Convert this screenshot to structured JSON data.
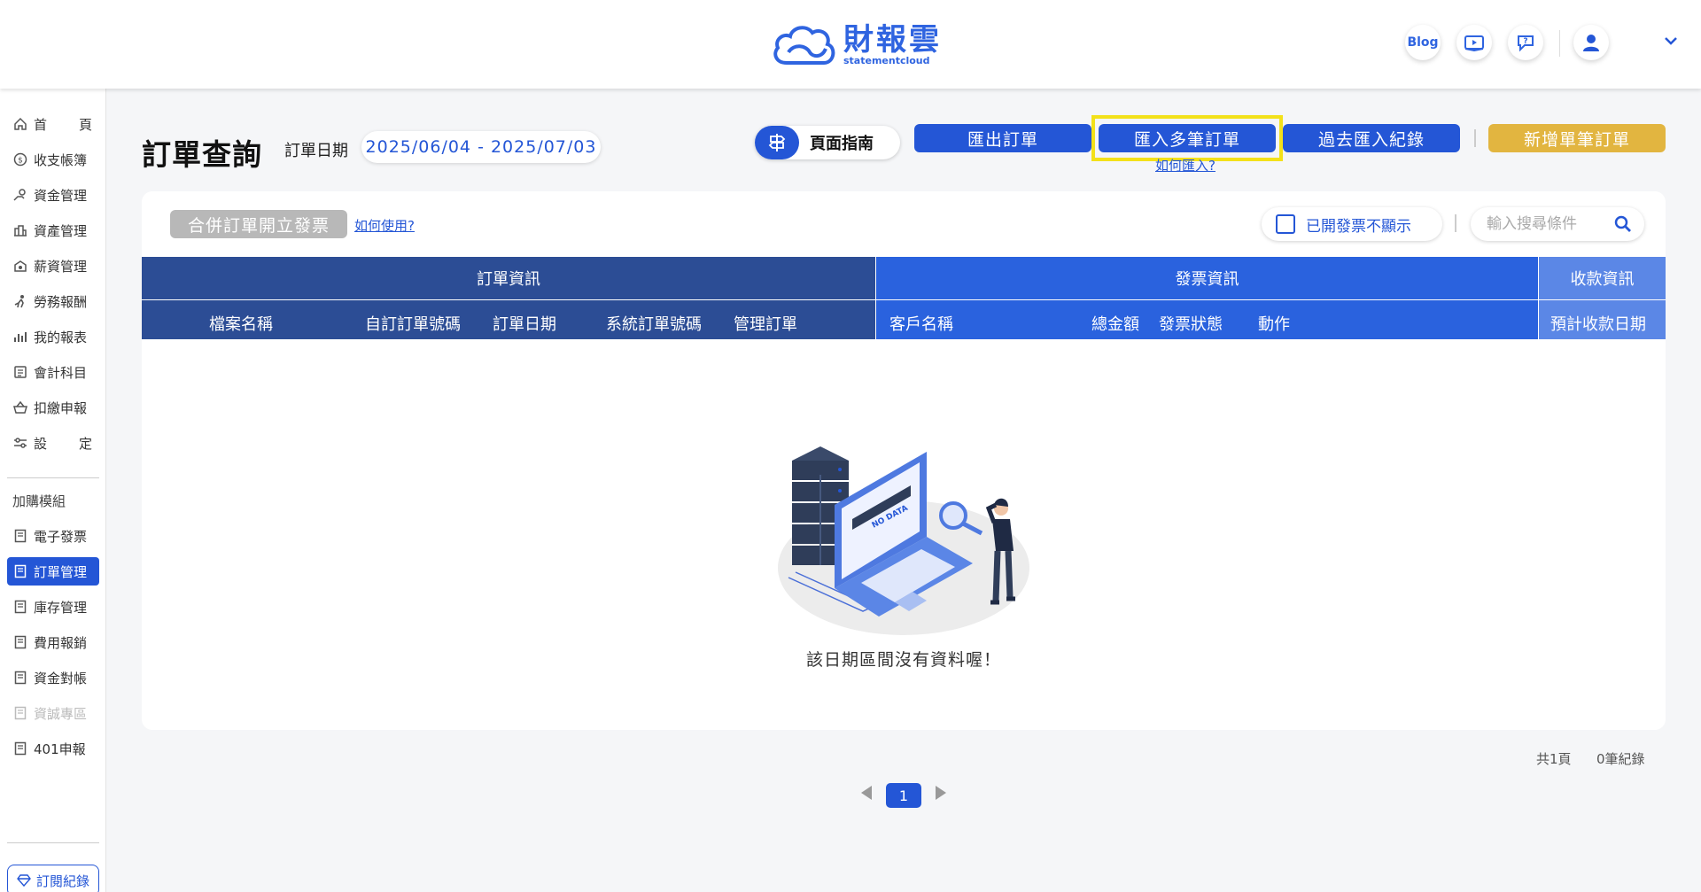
{
  "header": {
    "logo_cn": "財報雲",
    "logo_en": "statementcloud",
    "blog_label": "Blog"
  },
  "sidebar": {
    "items": [
      {
        "label_a": "首",
        "label_b": "頁",
        "icon": "home-icon"
      },
      {
        "label": "收支帳簿",
        "icon": "coin-icon"
      },
      {
        "label": "資金管理",
        "icon": "money-hand-icon"
      },
      {
        "label": "資產管理",
        "icon": "building-icon"
      },
      {
        "label": "薪資管理",
        "icon": "salary-icon"
      },
      {
        "label": "勞務報酬",
        "icon": "worker-icon"
      },
      {
        "label": "我的報表",
        "icon": "bar-chart-icon"
      },
      {
        "label": "會計科目",
        "icon": "ledger-icon"
      },
      {
        "label": "扣繳申報",
        "icon": "basket-icon"
      },
      {
        "label_a": "設",
        "label_b": "定",
        "icon": "sliders-icon"
      }
    ],
    "addon_heading": "加購模組",
    "addons": [
      {
        "label": "電子發票",
        "icon": "document-icon"
      },
      {
        "label": "訂單管理",
        "icon": "document-icon",
        "active": true
      },
      {
        "label": "庫存管理",
        "icon": "document-icon"
      },
      {
        "label": "費用報銷",
        "icon": "document-icon"
      },
      {
        "label": "資金對帳",
        "icon": "document-icon"
      },
      {
        "label": "資誠專區",
        "icon": "document-icon",
        "disabled": true
      },
      {
        "label": "401申報",
        "icon": "document-icon"
      }
    ],
    "subscription_label": "訂閱紀錄"
  },
  "page": {
    "title": "訂單查詢",
    "date_label": "訂單日期",
    "date_range": "2025/06/04 - 2025/07/03",
    "guide_label": "頁面指南",
    "export_label": "匯出訂單",
    "import_multi_label": "匯入多筆訂單",
    "import_history_label": "過去匯入紀錄",
    "new_order_label": "新增單筆訂單",
    "how_import_label": "如何匯入?",
    "merge_invoice_label": "合併訂單開立發票",
    "how_use_label": "如何使用?",
    "hide_invoiced_label": "已開發票不顯示",
    "search_placeholder": "輸入搜尋條件"
  },
  "table": {
    "groups": {
      "order_info": "訂單資訊",
      "invoice_info": "發票資訊",
      "payment_info": "收款資訊"
    },
    "columns": {
      "file_name": "檔案名稱",
      "custom_order_no": "自訂訂單號碼",
      "order_date": "訂單日期",
      "system_order_no": "系統訂單號碼",
      "manage_order": "管理訂單",
      "customer_name": "客戶名稱",
      "total_amount": "總金額",
      "invoice_status": "發票狀態",
      "action": "動作",
      "expected_payment_date": "預計收款日期"
    },
    "empty_illustration_text": "NO DATA",
    "empty_message": "該日期區間沒有資料喔！"
  },
  "pagination": {
    "total_pages": "共1頁",
    "total_records": "0筆紀錄",
    "current_page": "1"
  },
  "colors": {
    "primary": "#2456d6",
    "header_dark": "#2c4d95",
    "header_mid": "#2a62de",
    "header_light": "#5b87e6",
    "new_order": "#e2b540",
    "highlight": "#f3e11a"
  }
}
